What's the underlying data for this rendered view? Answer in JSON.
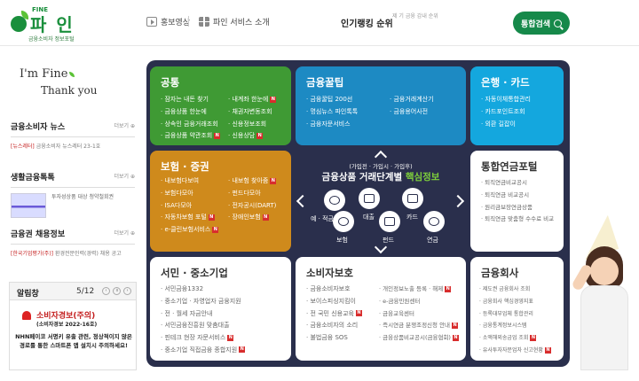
{
  "logo": {
    "fine": "FINE",
    "name": "파 인",
    "subtitle": "금융소비자 정보포털"
  },
  "header": {
    "promo_video": "홍보영상",
    "service_intro": "파인 서비스 소개",
    "ranking_label": "인기랭킹 순위",
    "ranking_item": "제 기 금융 감내 순위",
    "search_button": "통합검색"
  },
  "sidebar": {
    "greeting_line1": "I'm Fine",
    "greeting_line2": "Thank you",
    "news": {
      "title": "금융소비자 뉴스",
      "more": "더보기",
      "tag": "[뉴스레터]",
      "text": "금융소비자 뉴스레터 23-1호"
    },
    "tips": {
      "title": "생활금융톡톡",
      "more": "더보기",
      "text": "투자성상품 대상 청약철회권"
    },
    "jobs": {
      "title": "금융권 채용정보",
      "more": "더보기",
      "tag": "[한국기업평가(주)]",
      "text": "환경전문인력(경력) 채용 공고"
    },
    "alarm": {
      "title": "알림창",
      "page": "5/12",
      "prev": "‹",
      "pause": "॥",
      "next": "›",
      "warning": "소비자경보(주의)",
      "number": "(소비자경보 2022-16호)",
      "message": "NHN페이코 서명키 유출 관련, 정상적이지 않은 경로를 통한 스마트폰 앱 설치시 주의하세요!"
    }
  },
  "cards": {
    "common": {
      "title": "공통",
      "col1": [
        "잠자는 내돈 찾기",
        "금융상품 한눈에",
        "상속인 금융거래조회",
        "금융상품 약관조회"
      ],
      "col1_new": [
        false,
        false,
        false,
        true
      ],
      "col2": [
        "내계좌 한눈에",
        "채권자변동조회",
        "신용정보조회",
        "신용상담"
      ],
      "col2_new": [
        true,
        false,
        false,
        true
      ]
    },
    "tips": {
      "title": "금융꿀팁",
      "col1": [
        "금융꿀팁 200선",
        "명심뉴스 파인톡톡",
        "금융자문서비스"
      ],
      "col2": [
        "금융거래계산기",
        "금융용어사전"
      ]
    },
    "bank": {
      "title": "은행 · 카드",
      "items": [
        "자동이체통합관리",
        "카드포인트조회",
        "외환 길잡이"
      ]
    },
    "insurance": {
      "title": "보험 · 증권",
      "col1": [
        "내보험다보여",
        "보험다모아",
        "ISA다모아",
        "자동차보험 포털",
        "e-클린보험서비스"
      ],
      "col1_new": [
        false,
        false,
        false,
        true,
        true
      ],
      "col2": [
        "내보험 찾아줌",
        "펀드다모아",
        "전자공시(DART)",
        "장애인보험"
      ],
      "col2_new": [
        true,
        false,
        false,
        true
      ]
    },
    "pension": {
      "title": "통합연금포털",
      "items": [
        "퇴직연금비교공시",
        "퇴직연금 비교공시",
        "원리금보장연금상품",
        "퇴직연금 맞춤형 수수료 비교"
      ]
    },
    "smb": {
      "title": "서민 · 중소기업",
      "items": [
        "서민금융1332",
        "중소기업 · 자영업자 금융지원",
        "전 · 월세 자금안내",
        "서민금융진흥원 맞춤대출",
        "핀테크 현장 자문서비스",
        "중소기업 직접금융 종합지원"
      ],
      "items_new": [
        false,
        false,
        false,
        false,
        true,
        true
      ]
    },
    "consumer": {
      "title": "소비자보호",
      "col1": [
        "금융소비자보호",
        "보이스피싱지킴이",
        "전 국민 신용교육",
        "금융소비자의 소리",
        "불법금융 SOS"
      ],
      "col1_new": [
        false,
        false,
        true,
        false,
        false
      ],
      "col2": [
        "개인정보노출 등록 · 해제",
        "e-금융민원센터",
        "금융교육센터",
        "즉시연금 분쟁조정신청 안내",
        "금융상품비교공시(금융협회)"
      ],
      "col2_new": [
        true,
        false,
        false,
        true,
        true
      ]
    },
    "company": {
      "title": "금융회사",
      "items": [
        "제도권 금융회사 조회",
        "금융회사 핵심경영지표",
        "등록대부업체 통합관리",
        "금융통계정보시스템",
        "소액해외송금업 조회",
        "유사투자자문업자 신고현황"
      ],
      "items_new": [
        false,
        false,
        false,
        false,
        true,
        true
      ]
    }
  },
  "center": {
    "subtitle": "(가입전 · 가입시 · 가입후)",
    "title": "금융상품 거래단계별",
    "title_highlight": "핵심정보",
    "items": [
      "예 · 적금",
      "대출",
      "카드",
      "보험",
      "펀드",
      "연금"
    ]
  },
  "new_badge": "N"
}
